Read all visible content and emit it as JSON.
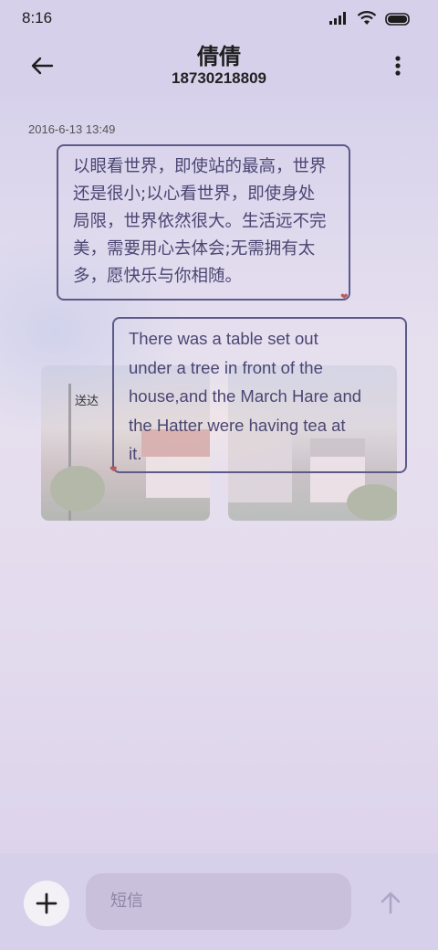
{
  "status_bar": {
    "time": "8:16",
    "icons": [
      "signal-icon",
      "wifi-icon",
      "battery-icon"
    ]
  },
  "header": {
    "contact_name": "倩倩",
    "contact_number": "18730218809",
    "back_icon": "back-arrow-icon",
    "more_icon": "more-vertical-icon"
  },
  "conversation": {
    "timestamp": "2016-6-13 13:49",
    "messages": [
      {
        "direction": "incoming",
        "lines": [
          "以眼看世界，即使站的最高，世界",
          "还是很小;以心看世界，即使身处",
          "局限，世界依然很大。生活远不完",
          "美，需要用心去体会;无需拥有太",
          "多，愿快乐与你相随。"
        ]
      },
      {
        "direction": "outgoing",
        "lines": [
          "There was a table set out",
          "under a tree in front of the",
          "house,and the March Hare and",
          "the Hatter were having tea at",
          "it."
        ],
        "status": "送达"
      }
    ]
  },
  "composer": {
    "placeholder": "短信",
    "add_icon": "plus-icon",
    "send_icon": "send-arrow-icon"
  },
  "colors": {
    "background": "#dcd6ec",
    "bubble_border": "#5e5a88",
    "bubble_text": "#4b4673",
    "input_bg": "#c9c1dc"
  }
}
